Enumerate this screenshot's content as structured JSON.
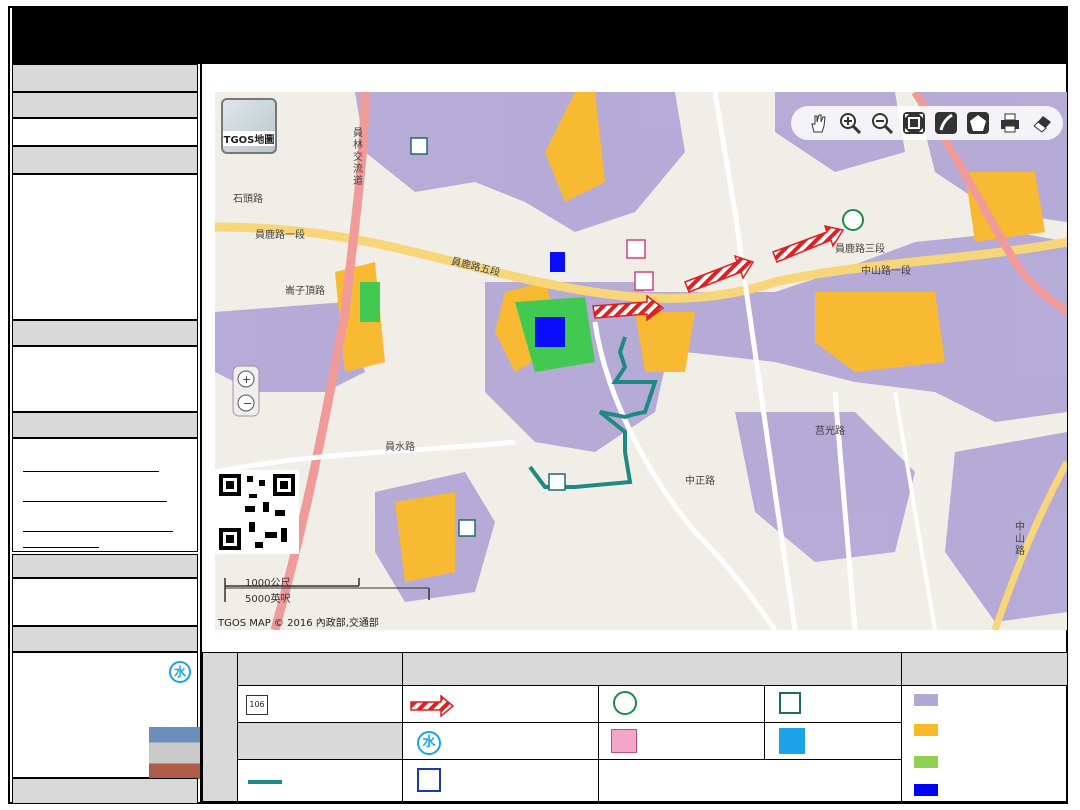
{
  "map": {
    "road_labels": [
      "員林交流道",
      "員鹿路一段",
      "員鹿路五段",
      "中山路一段",
      "員鹿路三段",
      "石頭路",
      "崙子頂路",
      "員水路",
      "莒光路",
      "中正路",
      "中山路"
    ],
    "tgos_button_label": "TGOS地圖",
    "scale": {
      "metric": "1000公尺",
      "imperial": "5000英呎"
    },
    "copyright": "TGOS MAP © 2016 內政部,交通部",
    "toolbar_icons": [
      "hand-pan-icon",
      "zoom-in-icon",
      "zoom-out-icon",
      "full-extent-icon",
      "draw-line-icon",
      "draw-polygon-icon",
      "print-icon",
      "eraser-icon"
    ]
  },
  "legend": {
    "route_badge": "106",
    "water_icon_glyph": "水",
    "density_colors": [
      "#b3a7d6",
      "#f9b82a",
      "#92d050",
      "#0000ff"
    ],
    "route_line_color": "#1e8a82",
    "arrow_color": "#e02020"
  },
  "left_panel": {
    "water_icon_glyph": "水"
  }
}
